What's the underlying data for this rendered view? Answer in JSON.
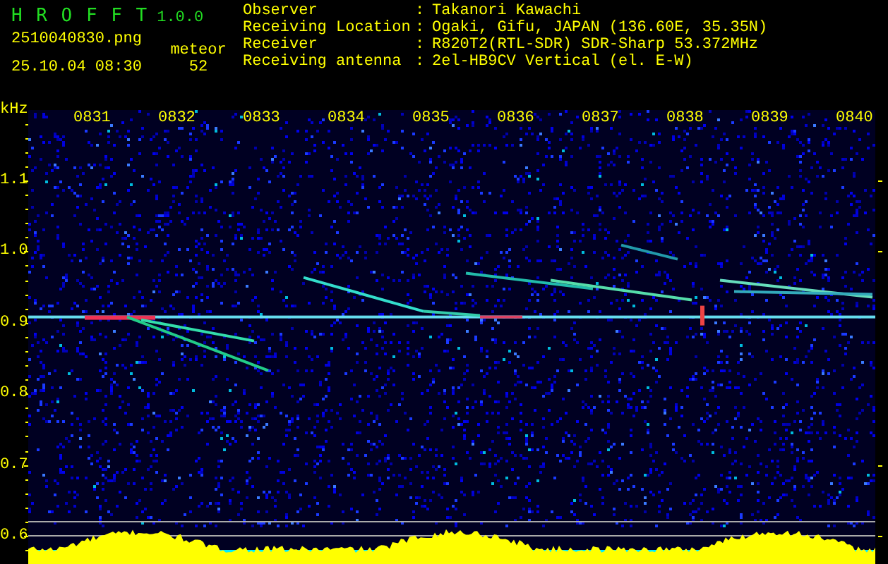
{
  "header": {
    "title": "H R O F F T",
    "version": "1.0.0",
    "filename": "2510040830.png",
    "datetime": "25.10.04 08:30",
    "count_label": "meteor",
    "count": "52"
  },
  "station": [
    {
      "label": "Observer",
      "separator": ":",
      "value": "Takanori Kawachi"
    },
    {
      "label": "Receiving Location",
      "separator": ":",
      "value": "Ogaki, Gifu, JAPAN (136.60E, 35.35N)"
    },
    {
      "label": "Receiver",
      "separator": ":",
      "value": "R820T2(RTL-SDR) SDR-Sharp 53.372MHz"
    },
    {
      "label": "Receiving antenna",
      "separator": ":",
      "value": "2el-HB9CV Vertical (el. E-W)"
    }
  ],
  "spectrogram": {
    "unit": "kHz",
    "frequency_labels": [
      "1.1",
      "1.0",
      "0.9",
      "0.8",
      "0.7",
      "0.6"
    ],
    "time_labels": [
      "0831",
      "0832",
      "0833",
      "0834",
      "0835",
      "0836",
      "0837",
      "0838",
      "0839",
      "0840"
    ]
  }
}
